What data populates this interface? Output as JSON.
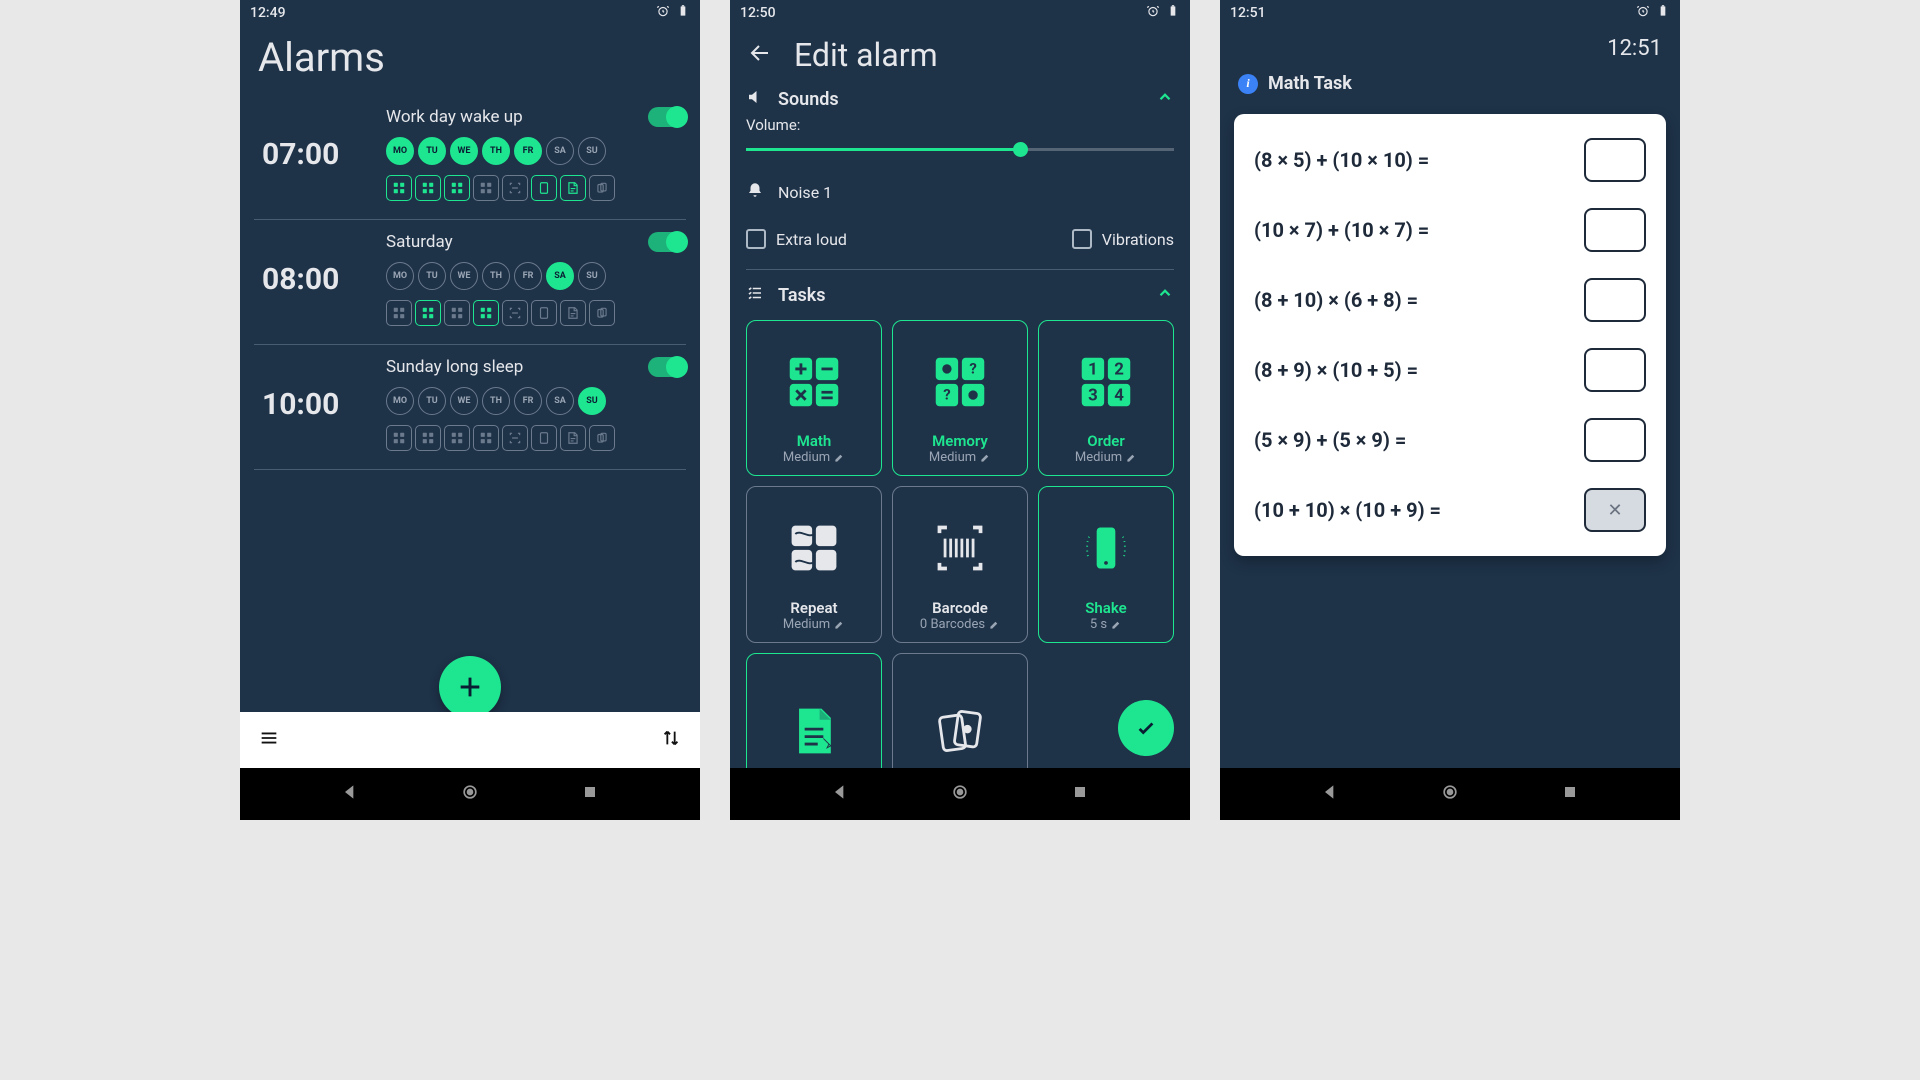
{
  "screen1": {
    "status_time": "12:49",
    "title": "Alarms",
    "alarms": [
      {
        "time": "07:00",
        "title": "Work day wake up",
        "enabled": true,
        "days": [
          {
            "d": "MO",
            "a": true
          },
          {
            "d": "TU",
            "a": true
          },
          {
            "d": "WE",
            "a": true
          },
          {
            "d": "TH",
            "a": true
          },
          {
            "d": "FR",
            "a": true
          },
          {
            "d": "SA",
            "a": false
          },
          {
            "d": "SU",
            "a": false
          }
        ],
        "tasks": [
          true,
          true,
          true,
          false,
          false,
          true,
          true,
          false
        ]
      },
      {
        "time": "08:00",
        "title": "Saturday",
        "enabled": true,
        "days": [
          {
            "d": "MO",
            "a": false
          },
          {
            "d": "TU",
            "a": false
          },
          {
            "d": "WE",
            "a": false
          },
          {
            "d": "TH",
            "a": false
          },
          {
            "d": "FR",
            "a": false
          },
          {
            "d": "SA",
            "a": true
          },
          {
            "d": "SU",
            "a": false
          }
        ],
        "tasks": [
          false,
          true,
          false,
          true,
          false,
          false,
          false,
          false
        ]
      },
      {
        "time": "10:00",
        "title": "Sunday long sleep",
        "enabled": true,
        "days": [
          {
            "d": "MO",
            "a": false
          },
          {
            "d": "TU",
            "a": false
          },
          {
            "d": "WE",
            "a": false
          },
          {
            "d": "TH",
            "a": false
          },
          {
            "d": "FR",
            "a": false
          },
          {
            "d": "SA",
            "a": false
          },
          {
            "d": "SU",
            "a": true
          }
        ],
        "tasks": [
          false,
          false,
          false,
          false,
          false,
          false,
          false,
          false
        ]
      }
    ]
  },
  "screen2": {
    "status_time": "12:50",
    "title": "Edit alarm",
    "sounds": {
      "label": "Sounds",
      "volume_label": "Volume:",
      "volume_pct": 64,
      "ringtone": "Noise 1",
      "extra_loud_label": "Extra loud",
      "extra_loud": false,
      "vibrations_label": "Vibrations",
      "vibrations": false
    },
    "tasks": {
      "label": "Tasks",
      "cards": [
        {
          "name": "Math",
          "sub": "Medium",
          "active": true,
          "icon": "math"
        },
        {
          "name": "Memory",
          "sub": "Medium",
          "active": true,
          "icon": "memory"
        },
        {
          "name": "Order",
          "sub": "Medium",
          "active": true,
          "icon": "order"
        },
        {
          "name": "Repeat",
          "sub": "Medium",
          "active": false,
          "icon": "repeat"
        },
        {
          "name": "Barcode",
          "sub": "0 Barcodes",
          "active": false,
          "icon": "barcode"
        },
        {
          "name": "Shake",
          "sub": "5 s",
          "active": true,
          "icon": "shake"
        },
        {
          "name": "",
          "sub": "",
          "active": true,
          "icon": "doc"
        },
        {
          "name": "",
          "sub": "",
          "active": false,
          "icon": "cards"
        }
      ]
    }
  },
  "screen3": {
    "status_time": "12:51",
    "big_time": "12:51",
    "task_label": "Math Task",
    "questions": [
      "(8 × 5) + (10 × 10) =",
      "(10 × 7) + (10 × 7) =",
      "(8 + 10) × (6 + 8) =",
      "(8 + 9) × (10 + 5) =",
      "(5 × 9) + (5 × 9) =",
      "(10 + 10) × (10 + 9) ="
    ]
  }
}
